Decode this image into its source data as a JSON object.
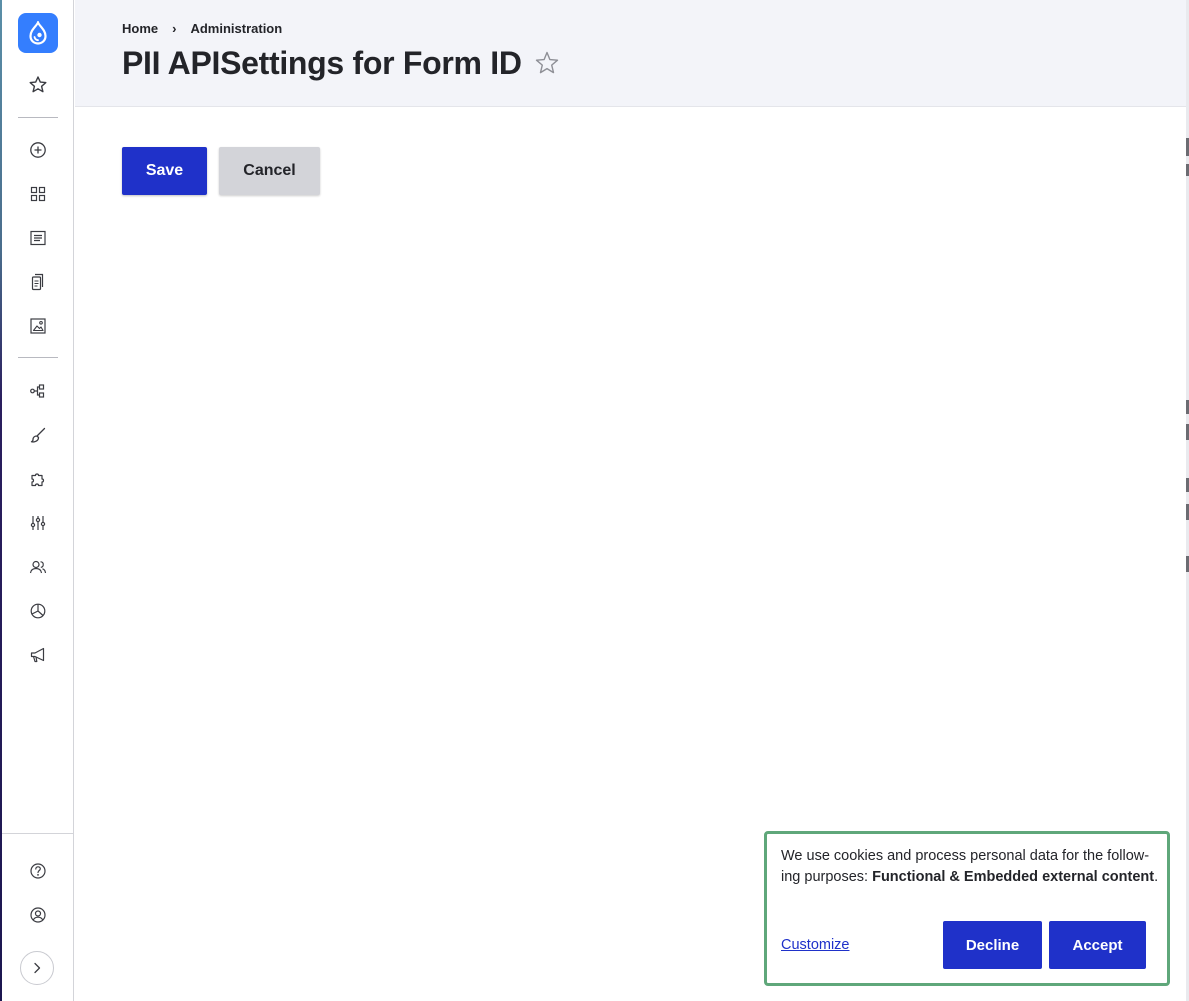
{
  "breadcrumb": {
    "home": "Home",
    "separator": "›",
    "administration": "Administration"
  },
  "page": {
    "title": "PII APISettings for Form ID",
    "favorite_glyph": "☆"
  },
  "actions": {
    "save_label": "Save",
    "cancel_label": "Cancel"
  },
  "sidebar": {
    "logo_icon": "drupal-drop-icon",
    "top_items": [
      {
        "icon": "star-icon"
      },
      {
        "icon": "plus-circle-icon"
      },
      {
        "icon": "grid-icon"
      },
      {
        "icon": "content-list-icon"
      },
      {
        "icon": "files-icon"
      },
      {
        "icon": "media-icon"
      },
      {
        "icon": "structure-icon"
      },
      {
        "icon": "brush-icon"
      },
      {
        "icon": "puzzle-icon"
      },
      {
        "icon": "sliders-icon"
      },
      {
        "icon": "people-icon"
      },
      {
        "icon": "reports-icon"
      },
      {
        "icon": "megaphone-icon"
      }
    ],
    "bottom_items": [
      {
        "icon": "help-icon"
      },
      {
        "icon": "user-icon"
      },
      {
        "icon": "chevron-right-icon"
      }
    ]
  },
  "cookie_banner": {
    "text_before": "We use cookies and process personal data for the follow­ing purposes: ",
    "text_bold": "Functional & Embedded external con­tent",
    "text_after": ".",
    "customize_label": "Customize",
    "decline_label": "Decline",
    "accept_label": "Accept"
  },
  "colors": {
    "primary": "#1f31c9",
    "logo_bg": "#347efe",
    "header_bg": "#f3f4f9",
    "cancel_bg": "#d3d4d9",
    "banner_border": "#5fa77a"
  }
}
